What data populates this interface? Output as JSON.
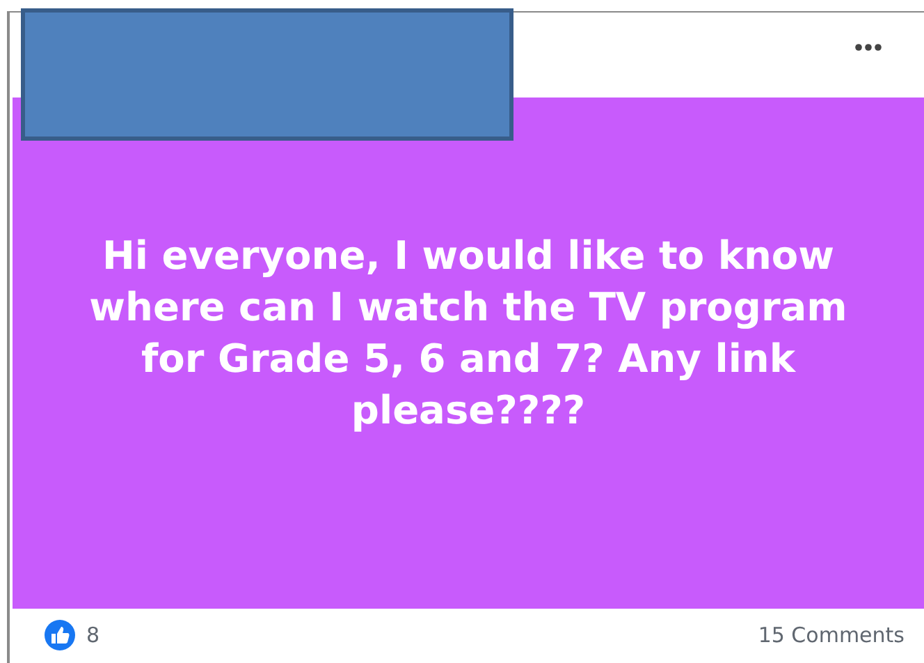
{
  "post": {
    "text": "Hi everyone, I would like to know where can I watch the TV program for Grade 5, 6 and 7? Any link please????"
  },
  "footer": {
    "reactions_count": "8",
    "comments": "15 Comments"
  }
}
